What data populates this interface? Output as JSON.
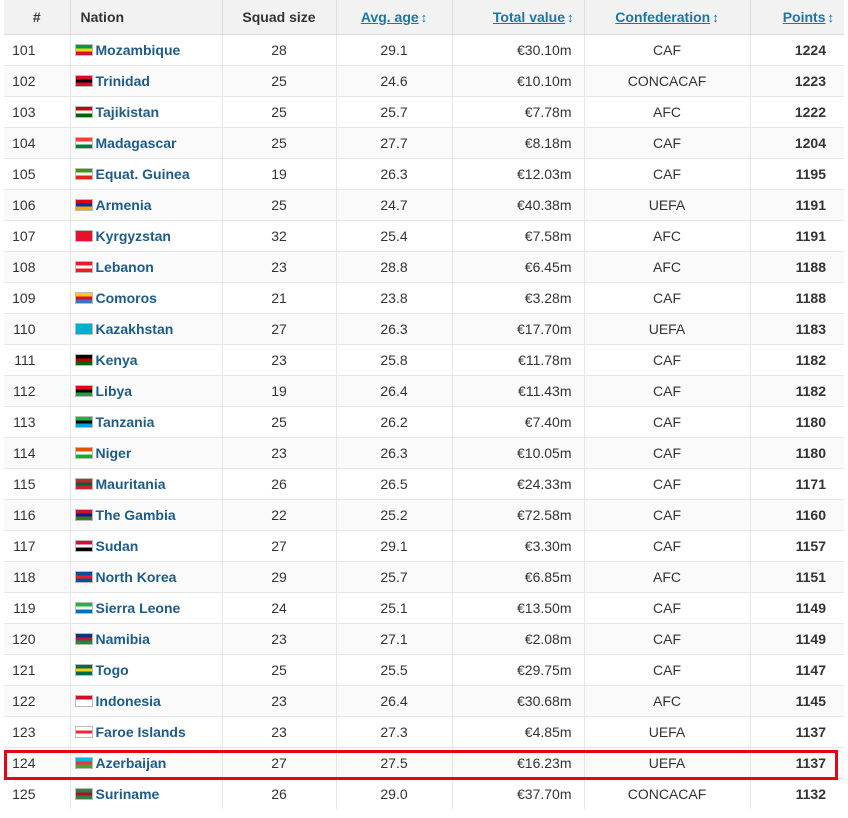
{
  "columns": {
    "rank": "#",
    "nation": "Nation",
    "squad": "Squad size",
    "age": "Avg. age",
    "value": "Total value",
    "conf": "Confederation",
    "points": "Points",
    "sort_glyph": "↕"
  },
  "colors": {
    "link": "#1d5b8a",
    "header_link": "#1d75a3",
    "trend_up": "#5d9a2e",
    "trend_down": "#b8171b",
    "trend_same": "#d5d5d5",
    "highlight": "#e30613"
  },
  "highlighted_rank": "124",
  "rows": [
    {
      "rank": "101",
      "trend": "same",
      "flag": [
        "#009a44",
        "#fcd116",
        "#d21034"
      ],
      "nation": "Mozambique",
      "squad": "28",
      "age": "29.1",
      "value": "€30.10m",
      "conf": "CAF",
      "points": "1224"
    },
    {
      "rank": "102",
      "trend": "down",
      "flag": [
        "#ce1126",
        "#000000",
        "#ce1126"
      ],
      "nation": "Trinidad",
      "squad": "25",
      "age": "24.6",
      "value": "€10.10m",
      "conf": "CONCACAF",
      "points": "1223"
    },
    {
      "rank": "103",
      "trend": "down",
      "flag": [
        "#cc0000",
        "#ffffff",
        "#006600"
      ],
      "nation": "Tajikistan",
      "squad": "25",
      "age": "25.7",
      "value": "€7.78m",
      "conf": "AFC",
      "points": "1222"
    },
    {
      "rank": "104",
      "trend": "same",
      "flag": [
        "#fc3d32",
        "#ffffff",
        "#007e3a"
      ],
      "nation": "Madagascar",
      "squad": "25",
      "age": "27.7",
      "value": "€8.18m",
      "conf": "CAF",
      "points": "1204"
    },
    {
      "rank": "105",
      "trend": "up",
      "flag": [
        "#3e9a00",
        "#ffffff",
        "#e32118"
      ],
      "nation": "Equat. Guinea",
      "squad": "19",
      "age": "26.3",
      "value": "€12.03m",
      "conf": "CAF",
      "points": "1195"
    },
    {
      "rank": "106",
      "trend": "down",
      "flag": [
        "#d90012",
        "#0033a0",
        "#f2a800"
      ],
      "nation": "Armenia",
      "squad": "25",
      "age": "24.7",
      "value": "€40.38m",
      "conf": "UEFA",
      "points": "1191"
    },
    {
      "rank": "107",
      "trend": "down",
      "flag": [
        "#e8112d",
        "#e8112d",
        "#e8112d"
      ],
      "nation": "Kyrgyzstan",
      "squad": "32",
      "age": "25.4",
      "value": "€7.58m",
      "conf": "AFC",
      "points": "1191"
    },
    {
      "rank": "108",
      "trend": "up",
      "flag": [
        "#ed1c24",
        "#ffffff",
        "#ed1c24"
      ],
      "nation": "Lebanon",
      "squad": "23",
      "age": "28.8",
      "value": "€6.45m",
      "conf": "AFC",
      "points": "1188"
    },
    {
      "rank": "109",
      "trend": "down",
      "flag": [
        "#ffc61e",
        "#ce1126",
        "#3a75c4"
      ],
      "nation": "Comoros",
      "squad": "21",
      "age": "23.8",
      "value": "€3.28m",
      "conf": "CAF",
      "points": "1188"
    },
    {
      "rank": "110",
      "trend": "up",
      "flag": [
        "#00afca",
        "#00afca",
        "#00afca"
      ],
      "nation": "Kazakhstan",
      "squad": "27",
      "age": "26.3",
      "value": "€17.70m",
      "conf": "UEFA",
      "points": "1183"
    },
    {
      "rank": "111",
      "trend": "up",
      "flag": [
        "#000000",
        "#bb0000",
        "#006600"
      ],
      "nation": "Kenya",
      "squad": "23",
      "age": "25.8",
      "value": "€11.78m",
      "conf": "CAF",
      "points": "1182"
    },
    {
      "rank": "112",
      "trend": "same",
      "flag": [
        "#e70013",
        "#000000",
        "#239e46"
      ],
      "nation": "Libya",
      "squad": "19",
      "age": "26.4",
      "value": "€11.43m",
      "conf": "CAF",
      "points": "1182"
    },
    {
      "rank": "113",
      "trend": "down",
      "flag": [
        "#1eb53a",
        "#000000",
        "#00a3dd"
      ],
      "nation": "Tanzania",
      "squad": "25",
      "age": "26.2",
      "value": "€7.40m",
      "conf": "CAF",
      "points": "1180"
    },
    {
      "rank": "114",
      "trend": "down",
      "flag": [
        "#e05206",
        "#ffffff",
        "#0db02b"
      ],
      "nation": "Niger",
      "squad": "23",
      "age": "26.3",
      "value": "€10.05m",
      "conf": "CAF",
      "points": "1180"
    },
    {
      "rank": "115",
      "trend": "same",
      "flag": [
        "#c1272d",
        "#006233",
        "#c1272d"
      ],
      "nation": "Mauritania",
      "squad": "26",
      "age": "26.5",
      "value": "€24.33m",
      "conf": "CAF",
      "points": "1171"
    },
    {
      "rank": "116",
      "trend": "same",
      "flag": [
        "#ce1126",
        "#0c1c8c",
        "#3a7728"
      ],
      "nation": "The Gambia",
      "squad": "22",
      "age": "25.2",
      "value": "€72.58m",
      "conf": "CAF",
      "points": "1160"
    },
    {
      "rank": "117",
      "trend": "same",
      "flag": [
        "#d21034",
        "#ffffff",
        "#000000"
      ],
      "nation": "Sudan",
      "squad": "27",
      "age": "29.1",
      "value": "€3.30m",
      "conf": "CAF",
      "points": "1157"
    },
    {
      "rank": "118",
      "trend": "up",
      "flag": [
        "#024fa2",
        "#ed1c27",
        "#024fa2"
      ],
      "nation": "North Korea",
      "squad": "29",
      "age": "25.7",
      "value": "€6.85m",
      "conf": "AFC",
      "points": "1151"
    },
    {
      "rank": "119",
      "trend": "up",
      "flag": [
        "#1eb53a",
        "#ffffff",
        "#0072c6"
      ],
      "nation": "Sierra Leone",
      "squad": "24",
      "age": "25.1",
      "value": "€13.50m",
      "conf": "CAF",
      "points": "1149"
    },
    {
      "rank": "120",
      "trend": "down",
      "flag": [
        "#003580",
        "#d21034",
        "#009543"
      ],
      "nation": "Namibia",
      "squad": "23",
      "age": "27.1",
      "value": "€2.08m",
      "conf": "CAF",
      "points": "1149"
    },
    {
      "rank": "121",
      "trend": "up",
      "flag": [
        "#006a4e",
        "#ffce00",
        "#006a4e"
      ],
      "nation": "Togo",
      "squad": "25",
      "age": "25.5",
      "value": "€29.75m",
      "conf": "CAF",
      "points": "1147"
    },
    {
      "rank": "122",
      "trend": "same",
      "flag": [
        "#ce1126",
        "#ffffff",
        "#ffffff"
      ],
      "nation": "Indonesia",
      "squad": "23",
      "age": "26.4",
      "value": "€30.68m",
      "conf": "AFC",
      "points": "1145"
    },
    {
      "rank": "123",
      "trend": "up",
      "flag": [
        "#ffffff",
        "#ed2939",
        "#ffffff"
      ],
      "nation": "Faroe Islands",
      "squad": "23",
      "age": "27.3",
      "value": "€4.85m",
      "conf": "UEFA",
      "points": "1137"
    },
    {
      "rank": "124",
      "trend": "up",
      "flag": [
        "#00b5e2",
        "#ef3340",
        "#509e2f"
      ],
      "nation": "Azerbaijan",
      "squad": "27",
      "age": "27.5",
      "value": "€16.23m",
      "conf": "UEFA",
      "points": "1137"
    },
    {
      "rank": "125",
      "trend": "down",
      "flag": [
        "#377e3f",
        "#b40a2d",
        "#377e3f"
      ],
      "nation": "Suriname",
      "squad": "26",
      "age": "29.0",
      "value": "€37.70m",
      "conf": "CONCACAF",
      "points": "1132"
    }
  ]
}
